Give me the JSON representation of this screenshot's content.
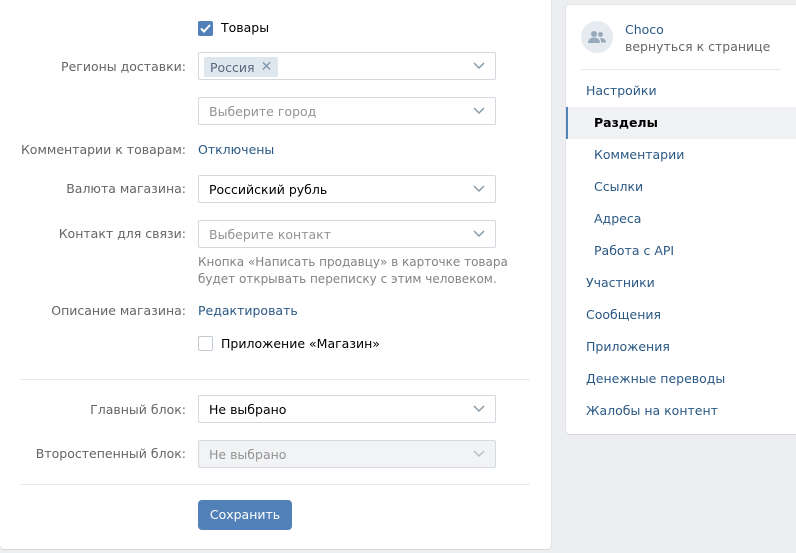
{
  "form": {
    "goods_checkbox_label": "Товары",
    "delivery_regions": {
      "label": "Регионы доставки:",
      "chip": "Россия",
      "city_placeholder": "Выберите город"
    },
    "comments": {
      "label": "Комментарии к товарам:",
      "value": "Отключены"
    },
    "currency": {
      "label": "Валюта магазина:",
      "value": "Российский рубль"
    },
    "contact": {
      "label": "Контакт для связи:",
      "placeholder": "Выберите контакт",
      "hint": "Кнопка «Написать продавцу» в карточке товара будет открывать переписку с этим человеком."
    },
    "description": {
      "label": "Описание магазина:",
      "link": "Редактировать"
    },
    "app_checkbox_label": "Приложение «Магазин»",
    "main_block": {
      "label": "Главный блок:",
      "value": "Не выбрано"
    },
    "secondary_block": {
      "label": "Второстепенный блок:",
      "value": "Не выбрано"
    },
    "save_label": "Сохранить"
  },
  "sidebar": {
    "group_name": "Choco",
    "back_link": "вернуться к странице",
    "items": [
      {
        "label": "Настройки"
      },
      {
        "label": "Разделы"
      },
      {
        "label": "Комментарии"
      },
      {
        "label": "Ссылки"
      },
      {
        "label": "Адреса"
      },
      {
        "label": "Работа с API"
      },
      {
        "label": "Участники"
      },
      {
        "label": "Сообщения"
      },
      {
        "label": "Приложения"
      },
      {
        "label": "Денежные переводы"
      },
      {
        "label": "Жалобы на контент"
      }
    ]
  },
  "colors": {
    "accent": "#5181b8",
    "link": "#2a5885",
    "background": "#edeef0"
  },
  "icons": {
    "checkbox_checked": "checkmark-icon",
    "chip_remove": "close-icon",
    "dropdown": "chevron-down-icon",
    "avatar": "community-icon"
  }
}
